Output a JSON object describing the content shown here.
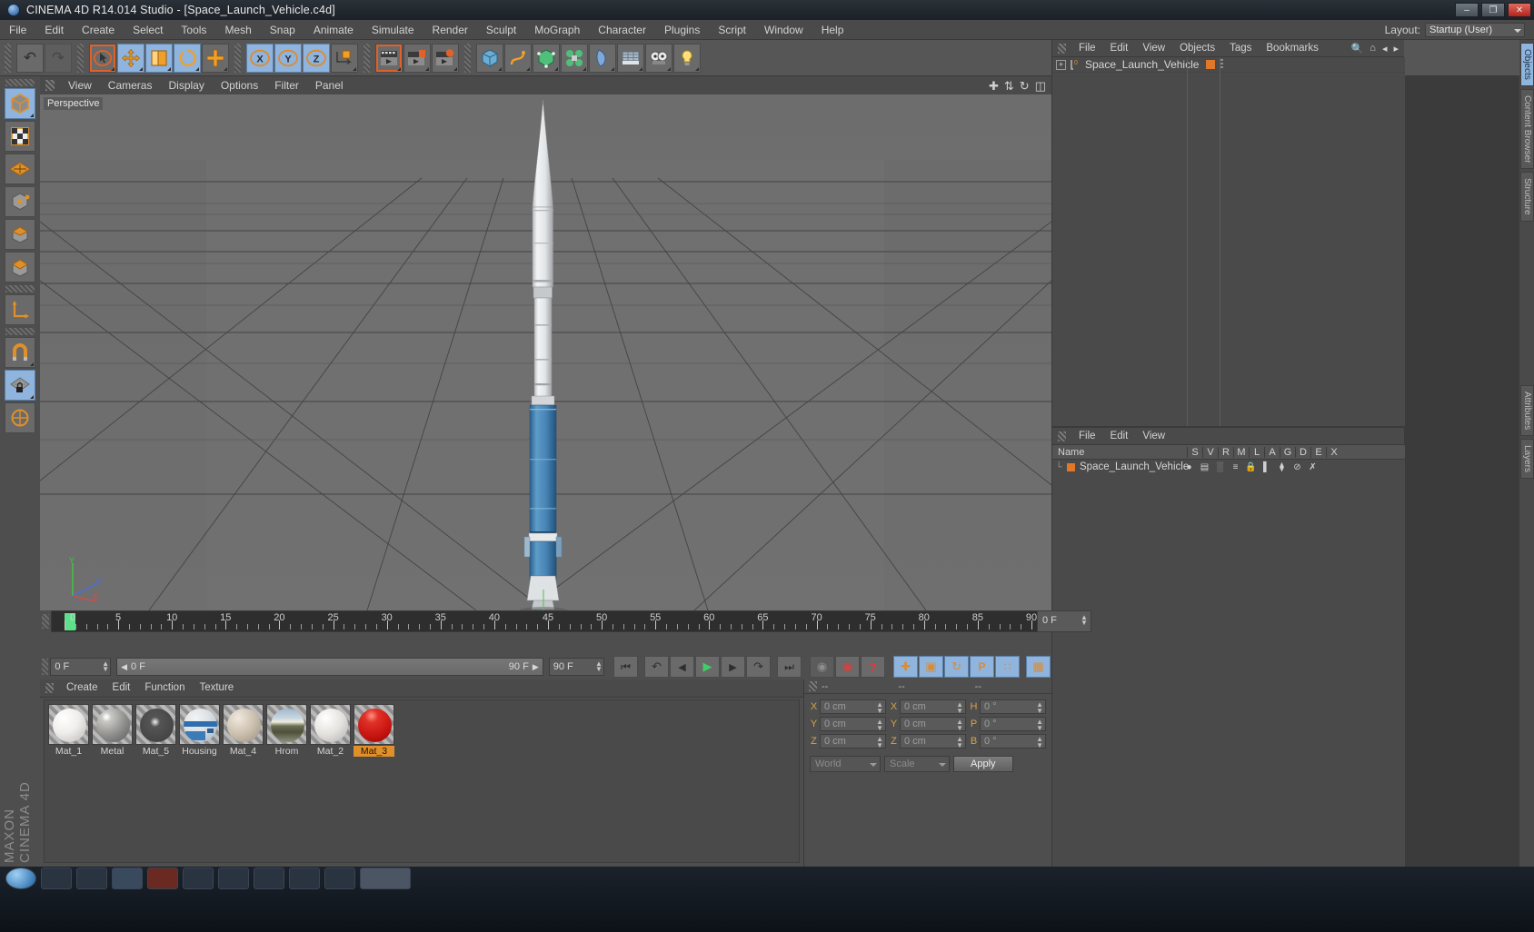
{
  "window": {
    "title": "CINEMA 4D R14.014 Studio - [Space_Launch_Vehicle.c4d]",
    "app_icon": "c4d-logo-icon",
    "minimize": "–",
    "maximize": "❐",
    "close": "✕"
  },
  "menubar": {
    "items": [
      "File",
      "Edit",
      "Create",
      "Select",
      "Tools",
      "Mesh",
      "Snap",
      "Animate",
      "Simulate",
      "Render",
      "Sculpt",
      "MoGraph",
      "Character",
      "Plugins",
      "Script",
      "Window",
      "Help"
    ],
    "layout_label": "Layout:",
    "layout_value": "Startup (User)"
  },
  "toolbar": {
    "groups": [
      {
        "name": "history",
        "buttons": [
          {
            "name": "undo-button",
            "icon": "↶",
            "state": "normal"
          },
          {
            "name": "redo-button",
            "icon": "↷",
            "state": "disabled"
          }
        ]
      },
      {
        "name": "transform",
        "buttons": [
          {
            "name": "live-selection-tool",
            "icon": "➤",
            "state": "selected"
          },
          {
            "name": "move-tool",
            "icon": "✚",
            "state": "active"
          },
          {
            "name": "scale-tool",
            "icon": "▣",
            "state": "active"
          },
          {
            "name": "rotate-tool",
            "icon": "↻",
            "state": "active"
          },
          {
            "name": "add-tool",
            "icon": "➕",
            "state": "normal"
          }
        ]
      },
      {
        "name": "axis-locks",
        "buttons": [
          {
            "name": "x-axis-lock-button",
            "icon": "X",
            "state": "active"
          },
          {
            "name": "y-axis-lock-button",
            "icon": "Y",
            "state": "active"
          },
          {
            "name": "z-axis-lock-button",
            "icon": "Z",
            "state": "active"
          },
          {
            "name": "world-object-coordinate-button",
            "icon": "⬚",
            "state": "normal"
          }
        ]
      },
      {
        "name": "render",
        "buttons": [
          {
            "name": "render-view-button",
            "icon": "▶",
            "state": "selected"
          },
          {
            "name": "render-region-button",
            "icon": "▶",
            "state": "normal"
          },
          {
            "name": "render-settings-button",
            "icon": "⚙",
            "state": "normal"
          }
        ]
      },
      {
        "name": "objects",
        "buttons": [
          {
            "name": "add-cube-object-button",
            "icon": "⬛",
            "state": "normal"
          },
          {
            "name": "add-spline-button",
            "icon": "⌇",
            "state": "normal"
          },
          {
            "name": "add-generator-button",
            "icon": "⬢",
            "state": "normal"
          },
          {
            "name": "add-mograph-button",
            "icon": "✵",
            "state": "normal"
          },
          {
            "name": "add-deformer-button",
            "icon": "◠",
            "state": "normal"
          },
          {
            "name": "add-scene-button",
            "icon": "▦",
            "state": "normal"
          },
          {
            "name": "add-camera-button",
            "icon": "⊙⊙",
            "state": "normal"
          },
          {
            "name": "add-light-button",
            "icon": "●",
            "state": "normal"
          }
        ]
      }
    ]
  },
  "left_palette": {
    "items": [
      {
        "name": "model-mode-button",
        "icon": "⬛",
        "state": "active"
      },
      {
        "name": "texture-mode-button",
        "icon": "▦",
        "state": "normal"
      },
      {
        "name": "polygon-mode-button",
        "icon": "◆",
        "state": "normal"
      },
      {
        "name": "points-mode-button",
        "icon": "⬛",
        "state": "normal"
      },
      {
        "name": "edges-mode-button",
        "icon": "⬛",
        "state": "normal"
      },
      {
        "name": "polygons-mode-button",
        "icon": "⬛",
        "state": "normal"
      },
      {
        "name": "axis-mode-button",
        "icon": "∟",
        "state": "normal"
      },
      {
        "name": "enable-snapping-button",
        "icon": "ᵘ",
        "state": "normal"
      },
      {
        "name": "workplane-lock-button",
        "icon": "▦",
        "state": "active"
      },
      {
        "name": "workplane-button",
        "icon": "↻",
        "state": "normal"
      }
    ]
  },
  "viewport": {
    "menu": [
      "View",
      "Cameras",
      "Display",
      "Options",
      "Filter",
      "Panel"
    ],
    "label": "Perspective",
    "axis": {
      "x": "X",
      "y": "Y",
      "z": "Z"
    },
    "corner_icons": [
      "move-view-icon",
      "scale-view-icon",
      "rotate-view-icon",
      "layout-view-icon"
    ],
    "scene_object": "Space_Launch_Vehicle rocket"
  },
  "object_manager": {
    "menu": [
      "File",
      "Edit",
      "View",
      "Objects",
      "Tags",
      "Bookmarks"
    ],
    "search_icon": "search-icon",
    "home_icon": "home-icon",
    "object": {
      "name": "Space_Launch_Vehicle",
      "expand": "+",
      "null_icon": "null-object-icon",
      "tag_color": "#e0782a"
    }
  },
  "attribute_manager": {
    "menu": [
      "File",
      "Edit",
      "View"
    ],
    "columns": [
      "Name",
      "S",
      "V",
      "R",
      "M",
      "L",
      "A",
      "G",
      "D",
      "E",
      "X"
    ],
    "rows": [
      {
        "name": "Space_Launch_Vehicle",
        "color": "#e0782a",
        "icons": [
          "●",
          "▣",
          "▒",
          "≡",
          "ὑ2",
          "▎",
          "⬡",
          "⊘",
          "✗"
        ]
      }
    ]
  },
  "side_tabs": [
    {
      "label": "Objects",
      "active": true
    },
    {
      "label": "Content Browser",
      "active": false
    },
    {
      "label": "Structure",
      "active": false
    },
    {
      "label": "Attributes",
      "active": false
    },
    {
      "label": "Layers",
      "active": false
    }
  ],
  "timeline": {
    "ticks": [
      0,
      5,
      10,
      15,
      20,
      25,
      30,
      35,
      40,
      45,
      50,
      55,
      60,
      65,
      70,
      75,
      80,
      85,
      90
    ],
    "current_frame_box": "0 F",
    "green_marker_frame": 0
  },
  "timeline_controls": {
    "start_frame": "0 F",
    "range_start": "0 F",
    "range_end": "90 F",
    "end_frame": "90 F",
    "buttons": [
      {
        "name": "go-to-start-button",
        "icon": "⏮"
      },
      {
        "name": "previous-key-button",
        "icon": "↺"
      },
      {
        "name": "previous-frame-button",
        "icon": "◀"
      },
      {
        "name": "play-button",
        "icon": "▶"
      },
      {
        "name": "next-frame-button",
        "icon": "▶"
      },
      {
        "name": "next-key-button",
        "icon": "↻"
      },
      {
        "name": "go-to-end-button",
        "icon": "⏭"
      },
      {
        "name": "record-active-objects-button",
        "icon": "◉"
      },
      {
        "name": "autokeying-button",
        "icon": "○"
      },
      {
        "name": "keyframe-selection-button",
        "icon": "?"
      },
      {
        "name": "position-key-button",
        "icon": "✚"
      },
      {
        "name": "scale-key-button",
        "icon": "▣"
      },
      {
        "name": "rotation-key-button",
        "icon": "↻"
      },
      {
        "name": "parameter-key-button",
        "icon": "P"
      },
      {
        "name": "point-level-animation-button",
        "icon": "∷"
      },
      {
        "name": "timeline-layout-button",
        "icon": "⌸"
      }
    ]
  },
  "material_manager": {
    "menu": [
      "Create",
      "Edit",
      "Function",
      "Texture"
    ],
    "materials": [
      {
        "name": "Mat_1",
        "color": "#efeeec",
        "selected": false
      },
      {
        "name": "Metal",
        "color": "#8e8e8c",
        "selected": false
      },
      {
        "name": "Mat_5",
        "color": "#4a4a4a",
        "selected": false
      },
      {
        "name": "Housing",
        "color": "#2e6fae",
        "selected": false
      },
      {
        "name": "Mat_4",
        "color": "#cbbfae",
        "selected": false
      },
      {
        "name": "Hrom",
        "color": "#93948c",
        "selected": false
      },
      {
        "name": "Mat_2",
        "color": "#e4e2de",
        "selected": false
      },
      {
        "name": "Mat_3",
        "color": "#d5201c",
        "selected": true
      }
    ]
  },
  "coordinates": {
    "headers": [
      "--",
      "--",
      "--"
    ],
    "rows": [
      {
        "label1": "X",
        "value1": "0 cm",
        "label2": "X",
        "value2": "0 cm",
        "label3": "H",
        "value3": "0 °"
      },
      {
        "label1": "Y",
        "value1": "0 cm",
        "label2": "Y",
        "value2": "0 cm",
        "label3": "P",
        "value3": "0 °"
      },
      {
        "label1": "Z",
        "value1": "0 cm",
        "label2": "Z",
        "value2": "0 cm",
        "label3": "B",
        "value3": "0 °"
      }
    ],
    "system": "World",
    "mode": "Scale",
    "apply_label": "Apply"
  },
  "watermark": {
    "brand": "MAXON",
    "product": "CINEMA 4D"
  },
  "colors": {
    "accent_orange": "#e0782a",
    "accent_blue": "#8fb4dd",
    "panel_bg": "#4e4e4e",
    "viewport_bg": "#6e6e6e"
  }
}
